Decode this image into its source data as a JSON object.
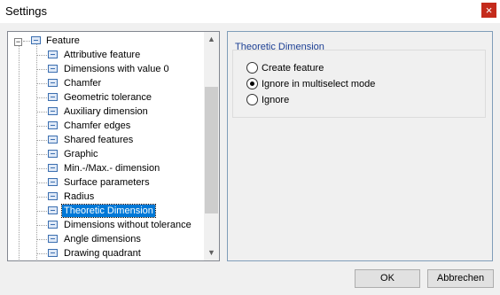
{
  "window": {
    "title": "Settings",
    "close_label": "×"
  },
  "tree": {
    "root": {
      "expander": "−",
      "label": "Feature"
    },
    "items": [
      "Attributive feature",
      "Dimensions with value 0",
      "Chamfer",
      "Geometric tolerance",
      "Auxiliary dimension",
      "Chamfer edges",
      "Shared features",
      "Graphic",
      "Min.-/Max.- dimension",
      "Surface parameters",
      "Radius",
      "Theoretic Dimension",
      "Dimensions without tolerance",
      "Angle dimensions",
      "Drawing quadrant"
    ],
    "selected": "Theoretic Dimension",
    "scroll_up": "▲",
    "scroll_down": "▼"
  },
  "options": {
    "group_title": "Theoretic Dimension",
    "radios": [
      {
        "label": "Create feature",
        "checked": false
      },
      {
        "label": "Ignore in multiselect mode",
        "checked": true
      },
      {
        "label": "Ignore",
        "checked": false
      }
    ]
  },
  "buttons": {
    "ok": "OK",
    "cancel": "Abbrechen"
  }
}
